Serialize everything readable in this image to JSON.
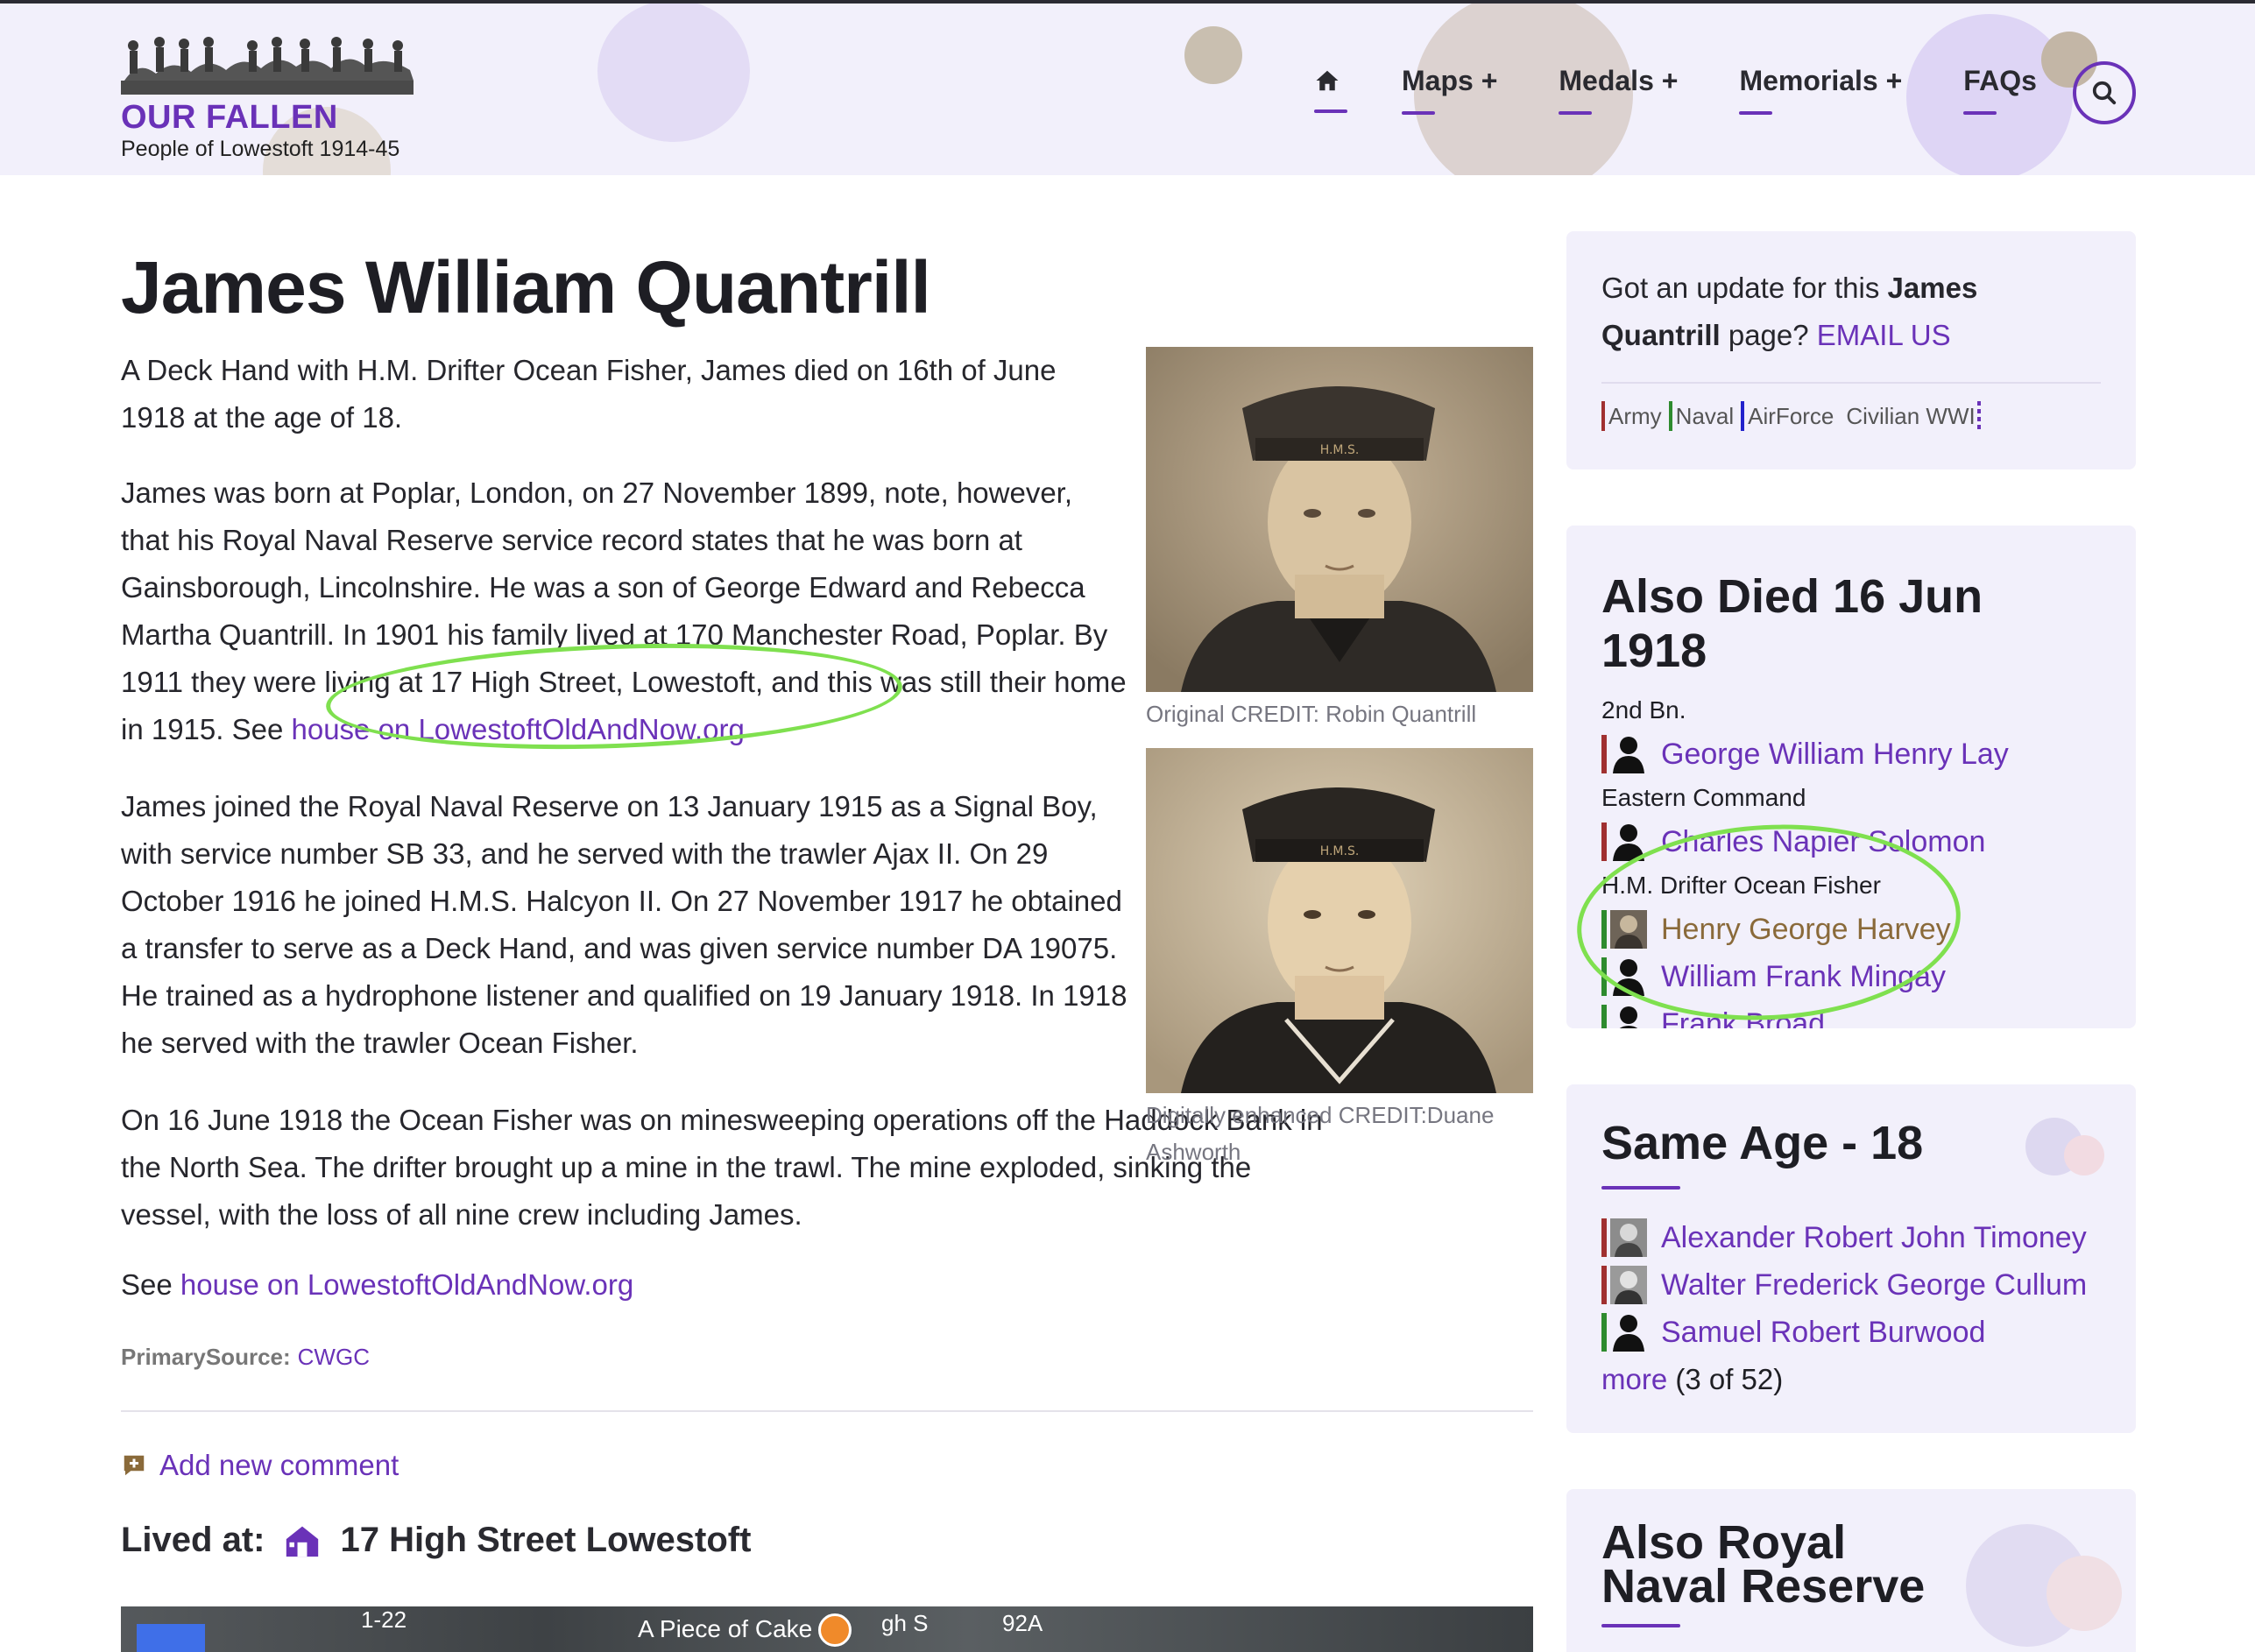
{
  "site": {
    "title": "OUR FALLEN",
    "subtitle": "People of Lowestoft 1914-45"
  },
  "nav": {
    "items": [
      {
        "label": "Maps +"
      },
      {
        "label": "Medals +"
      },
      {
        "label": "Memorials +"
      },
      {
        "label": "FAQs"
      }
    ]
  },
  "article": {
    "title": "James William Quantrill",
    "paragraphs": {
      "p1": "A Deck Hand with H.M. Drifter Ocean Fisher, James died on 16th of June 1918 at the age of 18.",
      "p2_text": "James was born at Poplar, London, on 27 November 1899, note, however, that his Royal Naval Reserve service record states that he was born at Gainsborough, Lincolnshire. He was a son of George Edward and Rebecca Martha Quantrill. In 1901 his family lived at 170 Manchester Road, Poplar. By 1911 they were living at 17 High Street, Lowestoft, and this was still their home in 1915. See ",
      "p2_link": "house on LowestoftOldAndNow.org",
      "p3": "James joined the Royal Naval Reserve on 13 January 1915 as a Signal Boy, with service number SB 33, and he served with the trawler Ajax II. On 29 October 1916 he joined H.M.S. Halcyon II. On 27 November 1917 he obtained a transfer to serve as a Deck Hand, and was given service number DA 19075. He trained as a hydrophone listener and qualified on 19 January 1918. In 1918 he served with the trawler Ocean Fisher.",
      "p4": "On 16 June 1918 the Ocean Fisher was on minesweeping operations off the Haddock Bank in the North Sea. The drifter brought up a mine in the trawl. The mine exploded, sinking the vessel, with the loss of all nine crew including James.",
      "p5_text": "See ",
      "p5_link": "house on LowestoftOldAndNow.org"
    },
    "photo1_caption": "Original CREDIT: Robin Quantrill",
    "photo2_caption": "Digitally enhanced CREDIT:Duane Ashworth",
    "source_label": "PrimarySource:",
    "source_link": "CWGC",
    "add_comment": "Add new comment",
    "lived_label": "Lived at:",
    "lived_address": "17 High Street Lowestoft",
    "map_labels": {
      "road": "1-22",
      "place": "A Piece of Cake",
      "num": "92A",
      "street": "gh S"
    }
  },
  "sidebar": {
    "update": {
      "text1": "Got an update for this ",
      "name": "James Quantrill",
      "text2": " page? ",
      "link": "EMAIL US",
      "legend": [
        "Army",
        "Naval",
        "AirForce",
        "Civilian WWI"
      ]
    },
    "also_died": {
      "title": "Also Died 16 Jun 1918",
      "groups": [
        {
          "unit": "2nd Bn.",
          "people": [
            "George William Henry Lay"
          ]
        },
        {
          "unit": "Eastern Command",
          "people": [
            "Charles Napier Solomon"
          ]
        },
        {
          "unit": "H.M. Drifter Ocean Fisher",
          "people": [
            "Henry George Harvey",
            "William Frank Mingay",
            "Frank Broad"
          ]
        }
      ]
    },
    "same_age": {
      "title": "Same Age - 18",
      "people": [
        "Alexander Robert John Timoney",
        "Walter Frederick George Cullum",
        "Samuel Robert Burwood"
      ],
      "more_link": "more",
      "more_count": "(3 of 52)"
    },
    "also_rnr": {
      "title": "Also Royal Naval Reserve"
    }
  },
  "colors": {
    "accent": "#6a32b8",
    "army": "#a03030",
    "naval": "#2e8b2e",
    "airforce": "#2222cc",
    "civilian": "#6a32b8",
    "highlight": "#7fe04f",
    "visited": "#8a6a3a"
  }
}
